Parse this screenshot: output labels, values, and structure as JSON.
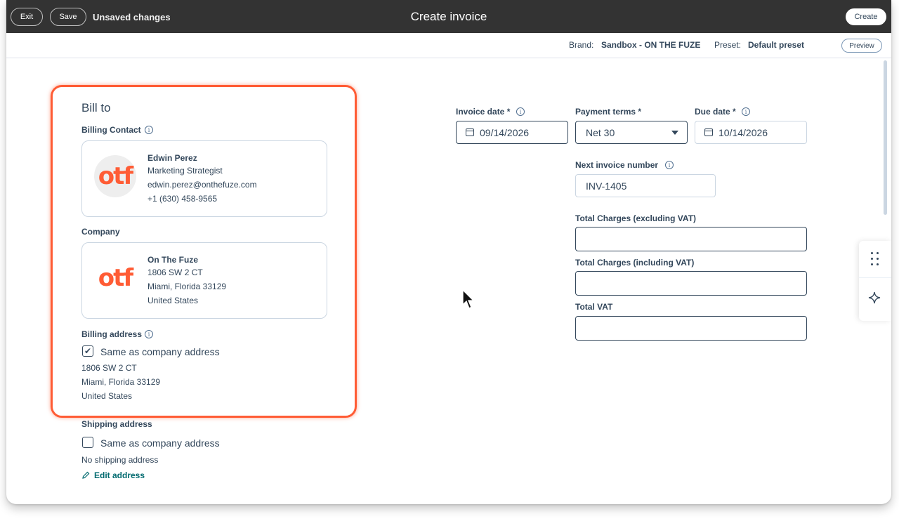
{
  "topbar": {
    "exit_label": "Exit",
    "save_label": "Save",
    "status": "Unsaved changes",
    "title": "Create invoice",
    "create_label": "Create"
  },
  "subbar": {
    "brand_label": "Brand:",
    "brand_value": "Sandbox - ON THE FUZE",
    "preset_label": "Preset:",
    "preset_value": "Default preset",
    "preview_label": "Preview"
  },
  "bill_to": {
    "heading": "Bill to",
    "billing_contact_label": "Billing Contact",
    "contact": {
      "logo": "otf",
      "name": "Edwin Perez",
      "title": "Marketing Strategist",
      "email": "edwin.perez@onthefuze.com",
      "phone": "+1 (630) 458-9565"
    },
    "company_label": "Company",
    "company": {
      "logo": "otf",
      "name": "On The Fuze",
      "street": "1806 SW 2 CT",
      "city": "Miami, Florida 33129",
      "country": "United States"
    },
    "billing_address_label": "Billing address",
    "billing_same_label": "Same as company address",
    "billing_same_checked": true,
    "billing_address": {
      "street": "1806 SW 2 CT",
      "city": "Miami, Florida 33129",
      "country": "United States"
    }
  },
  "shipping": {
    "label": "Shipping address",
    "same_label": "Same as company address",
    "same_checked": false,
    "empty_text": "No shipping address",
    "edit_label": "Edit address"
  },
  "form": {
    "invoice_date_label": "Invoice date *",
    "invoice_date_value": "09/14/2026",
    "payment_terms_label": "Payment terms *",
    "payment_terms_value": "Net 30",
    "due_date_label": "Due date *",
    "due_date_value": "10/14/2026",
    "next_invoice_label": "Next invoice number",
    "next_invoice_value": "INV-1405",
    "total_excl_label": "Total Charges (excluding VAT)",
    "total_excl_value": "",
    "total_incl_label": "Total Charges (including VAT)",
    "total_incl_value": "",
    "total_vat_label": "Total VAT",
    "total_vat_value": ""
  },
  "colors": {
    "topbar": "#333333",
    "accent_orange": "#ff5c35",
    "link_teal": "#006a6f",
    "text": "#33475b"
  },
  "icons": [
    "info-icon",
    "calendar-icon",
    "chevron-down-icon",
    "pencil-icon",
    "drag-grid-icon",
    "sparkle-icon",
    "mouse-cursor-icon"
  ]
}
